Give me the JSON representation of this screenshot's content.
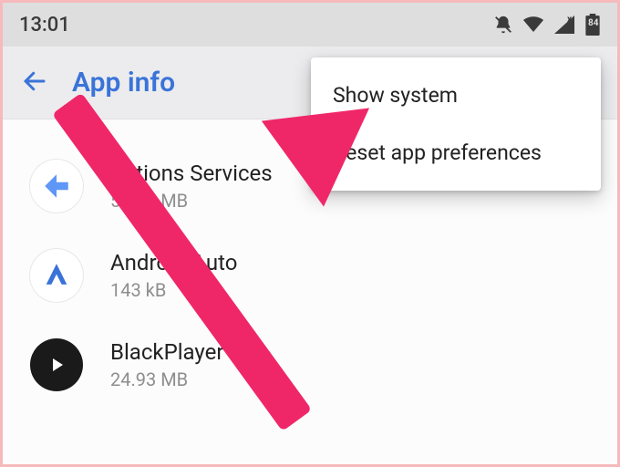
{
  "status_bar": {
    "time": "13:01",
    "battery": "84"
  },
  "app_bar": {
    "title": "App info"
  },
  "menu": {
    "items": [
      "Show system",
      "Reset app preferences"
    ]
  },
  "apps": [
    {
      "name": "Actions Services",
      "size": "54.38 MB"
    },
    {
      "name": "Android Auto",
      "size": "143 kB"
    },
    {
      "name": "BlackPlayer",
      "size": "24.93 MB"
    }
  ]
}
